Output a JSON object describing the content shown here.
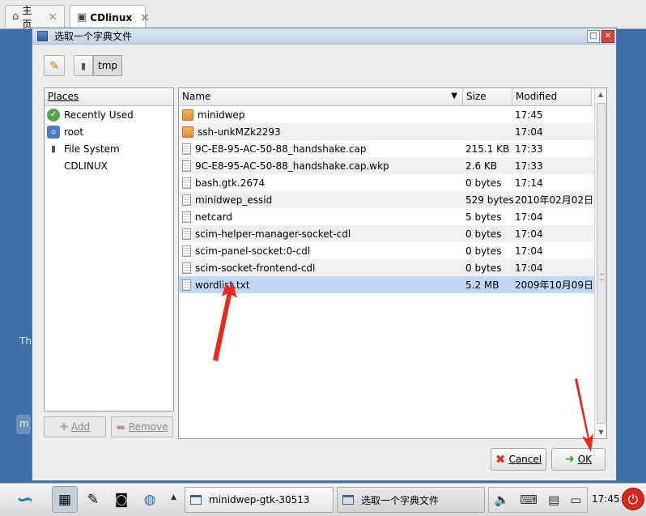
{
  "tabs": [
    {
      "label": "主页",
      "icon": "home-icon"
    },
    {
      "label": "CDlinux",
      "icon": "terminal-icon"
    }
  ],
  "desktop": {
    "fragment_text": "Th",
    "fragment_btn": "m"
  },
  "dialog": {
    "title": "选取一个字典文件",
    "path_buttons": {
      "current": "tmp"
    },
    "places_header": "Places",
    "places": [
      {
        "label": "Recently Used",
        "icon": "recent-icon"
      },
      {
        "label": "root",
        "icon": "home-folder-icon"
      },
      {
        "label": "File System",
        "icon": "drive-icon"
      },
      {
        "label": "CDLINUX",
        "icon": ""
      }
    ],
    "add_label": "Add",
    "remove_label": "Remove",
    "columns": {
      "name": "Name",
      "size": "Size",
      "modified": "Modified"
    },
    "files": [
      {
        "name": "minidwep",
        "size": "",
        "modified": "17:45",
        "type": "folder"
      },
      {
        "name": "ssh-unkMZk2293",
        "size": "",
        "modified": "17:04",
        "type": "folder"
      },
      {
        "name": "9C-E8-95-AC-50-88_handshake.cap",
        "size": "215.1 KB",
        "modified": "17:33",
        "type": "file"
      },
      {
        "name": "9C-E8-95-AC-50-88_handshake.cap.wkp",
        "size": "2.6 KB",
        "modified": "17:33",
        "type": "file"
      },
      {
        "name": "bash.gtk.2674",
        "size": "0 bytes",
        "modified": "17:14",
        "type": "file"
      },
      {
        "name": "minidwep_essid",
        "size": "529 bytes",
        "modified": "2010年02月02日",
        "type": "file"
      },
      {
        "name": "netcard",
        "size": "5 bytes",
        "modified": "17:04",
        "type": "file"
      },
      {
        "name": "scim-helper-manager-socket-cdl",
        "size": "0 bytes",
        "modified": "17:04",
        "type": "file"
      },
      {
        "name": "scim-panel-socket:0-cdl",
        "size": "0 bytes",
        "modified": "17:04",
        "type": "file"
      },
      {
        "name": "scim-socket-frontend-cdl",
        "size": "0 bytes",
        "modified": "17:04",
        "type": "file"
      },
      {
        "name": "wordlist.txt",
        "size": "5.2 MB",
        "modified": "2009年10月09日",
        "type": "file",
        "selected": true
      }
    ],
    "cancel_label": "Cancel",
    "ok_label": "OK"
  },
  "taskbar": {
    "windows": [
      {
        "label": "minidwep-gtk-30513"
      },
      {
        "label": "选取一个字典文件"
      }
    ],
    "clock": "17:45"
  },
  "colors": {
    "selection": "#bfd8f6",
    "annotation_arrow": "#e8281e"
  }
}
